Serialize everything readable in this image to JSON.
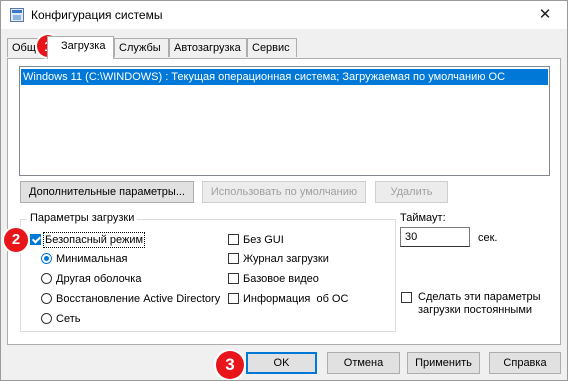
{
  "window": {
    "title": "Конфигурация системы",
    "close_glyph": "✕"
  },
  "tabs": [
    {
      "label": "Общие",
      "visible_label": "Общ"
    },
    {
      "label": "Загрузка"
    },
    {
      "label": "Службы"
    },
    {
      "label": "Автозагрузка"
    },
    {
      "label": "Сервис"
    }
  ],
  "active_tab": "Загрузка",
  "os_list": [
    "Windows 11 (C:\\WINDOWS) : Текущая операционная система; Загружаемая по умолчанию ОС"
  ],
  "buttons": {
    "advanced": "Дополнительные параметры...",
    "set_default": "Использовать по умолчанию",
    "delete": "Удалить"
  },
  "boot_options": {
    "group_title": "Параметры загрузки",
    "safe_boot": {
      "label": "Безопасный режим",
      "checked": true
    },
    "modes": [
      {
        "label": "Минимальная",
        "selected": true
      },
      {
        "label": "Другая оболочка",
        "selected": false
      },
      {
        "label": "Восстановление Active Directory",
        "selected": false
      },
      {
        "label": "Сеть",
        "selected": false
      }
    ],
    "flags": [
      {
        "label": "Без GUI",
        "checked": false
      },
      {
        "label": "Журнал загрузки",
        "checked": false
      },
      {
        "label": "Базовое видео",
        "checked": false
      },
      {
        "label": "Информация  об ОС",
        "checked": false
      }
    ]
  },
  "timeout": {
    "label": "Таймаут:",
    "value": "30",
    "unit": "сек."
  },
  "make_permanent": {
    "label": "Сделать эти параметры загрузки постоянными",
    "checked": false
  },
  "dialog_buttons": {
    "ok": "OK",
    "cancel": "Отмена",
    "apply": "Применить",
    "help": "Справка"
  },
  "markers": [
    "1",
    "2",
    "3"
  ],
  "colors": {
    "accent": "#0078d7",
    "marker": "#e8151b",
    "selection": "#0078d7"
  }
}
